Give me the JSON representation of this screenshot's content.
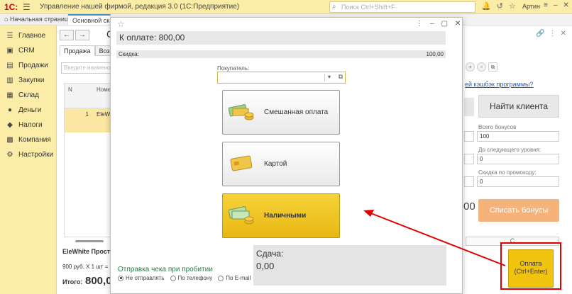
{
  "titlebar": {
    "logo": "1С:",
    "title": "Управление нашей фирмой, редакция 3.0  (1С:Предприятие)",
    "search_placeholder": "Поиск Ctrl+Shift+F",
    "user": "Артин"
  },
  "tabs": {
    "home": "Начальная страница",
    "main": "Основной ск"
  },
  "sidebar": {
    "items": [
      {
        "label": "Главное",
        "icon": "list-icon"
      },
      {
        "label": "CRM",
        "icon": "crm-icon"
      },
      {
        "label": "Продажи",
        "icon": "sales-icon"
      },
      {
        "label": "Закупки",
        "icon": "purchases-icon"
      },
      {
        "label": "Склад",
        "icon": "warehouse-icon"
      },
      {
        "label": "Деньги",
        "icon": "money-icon"
      },
      {
        "label": "Налоги",
        "icon": "taxes-icon"
      },
      {
        "label": "Компания",
        "icon": "company-icon"
      },
      {
        "label": "Настройки",
        "icon": "settings-icon"
      }
    ]
  },
  "background_form": {
    "title_initial": "С",
    "tab_sale": "Продажа",
    "tab_return": "Возвра",
    "field_placeholder": "Введите наименов",
    "table": {
      "col_n": "N",
      "col_name": "Номе",
      "row_n": "1",
      "row_name": "EleW"
    },
    "product": "EleWhite Простын",
    "price_line": "900 руб. X 1 шт = 9",
    "total_label": "Итого:",
    "total_value": "800,00"
  },
  "right_panel": {
    "cashback_link": "ей кэшбэк программы?",
    "find_client": "Найти клиента",
    "total_bonus_label": "Всего бонусов",
    "total_bonus_value": "100",
    "next_level_label": "До следующего уровня:",
    "next_level_value": "0",
    "promo_label": "Скидка по промокоду:",
    "promo_value": "0",
    "left_value": "00",
    "spend_bonus": "Списать бонусы",
    "refresh": "C",
    "collapse": "<"
  },
  "pay_button": {
    "line1": "Оплата",
    "line2": "(Ctrl+Enter)"
  },
  "modal": {
    "to_pay": "К оплате: 800,00",
    "discount_label": "Скидка:",
    "discount_value": "100,00",
    "buyer_label": "Покупатель:",
    "buttons": [
      {
        "label": "Смешанная оплата",
        "icon": "mixed-payment-icon"
      },
      {
        "label": "Картой",
        "icon": "card-icon"
      },
      {
        "label": "Наличными",
        "icon": "cash-icon"
      }
    ],
    "change_label": "Сдача:",
    "change_value": "0,00",
    "receipt_label": "Отправка чека при пробитии",
    "receipt_options": [
      "Не отправлять",
      "По телефону",
      "По E-mail"
    ],
    "receipt_selected": "Не отправлять"
  },
  "colors": {
    "accent_yellow": "#f0c30e",
    "sidebar_bg": "#fbeda8",
    "highlight_red": "#e00000",
    "spend_orange": "#f5b27a",
    "link_green": "#2a7a4a"
  }
}
